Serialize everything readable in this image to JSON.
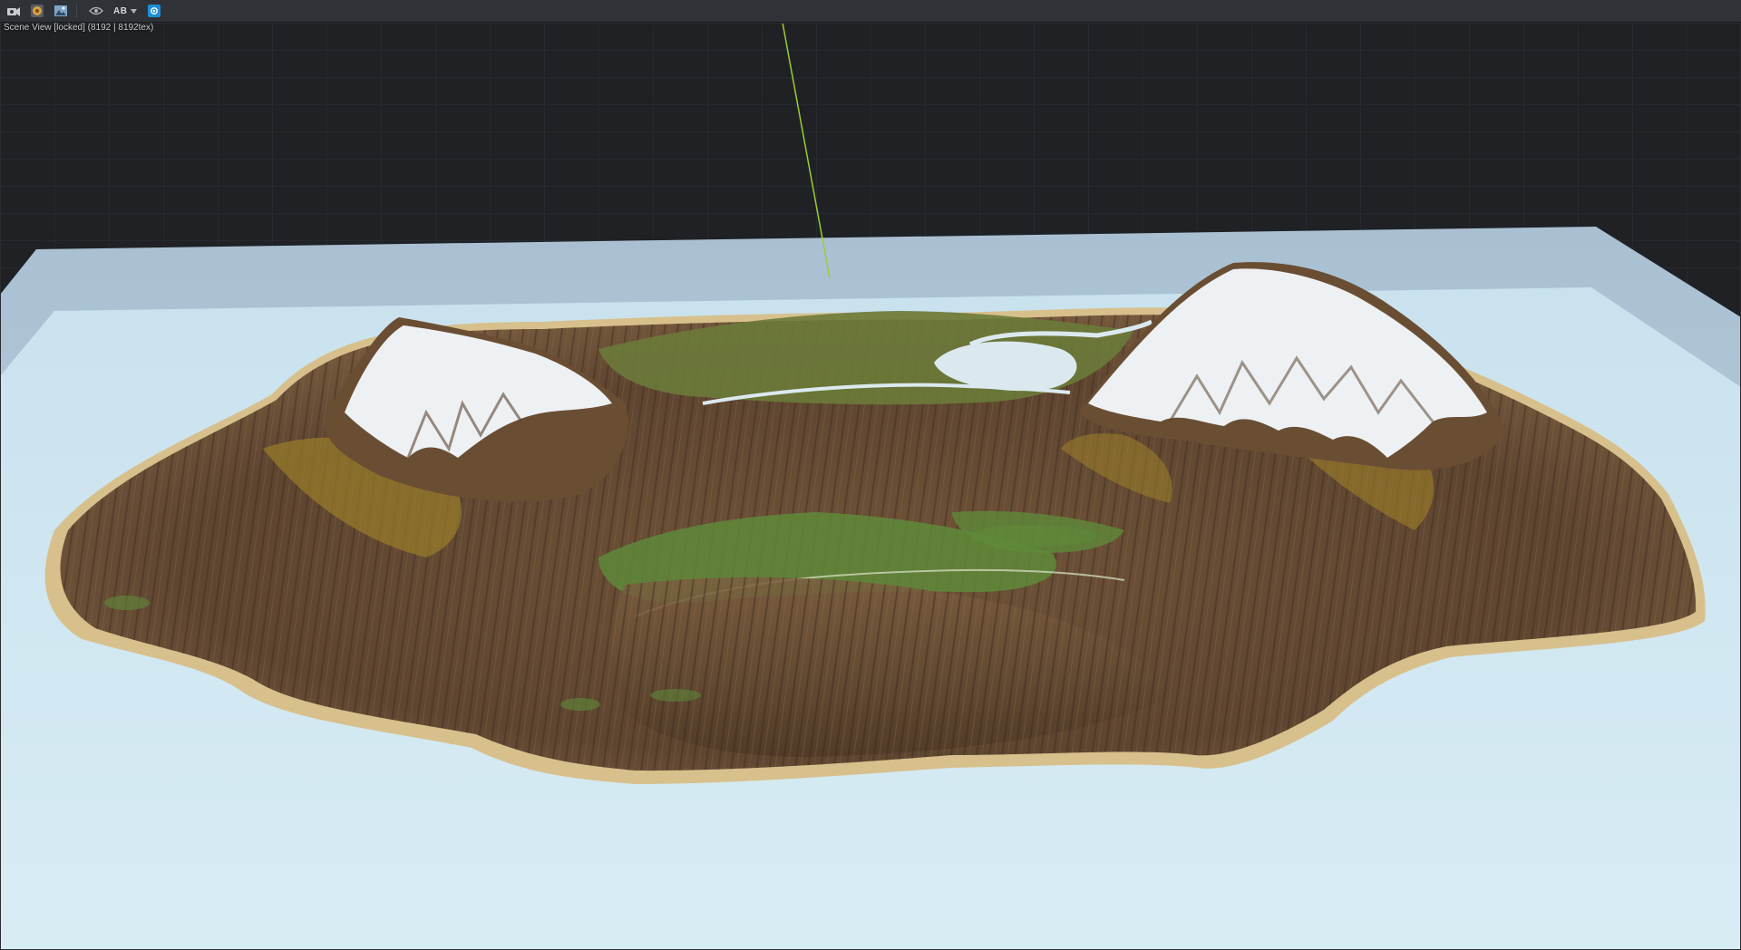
{
  "toolbar": {
    "buttons": [
      {
        "name": "camera-options-icon"
      },
      {
        "name": "render-settings-icon"
      },
      {
        "name": "image-export-icon"
      },
      {
        "name": "visibility-eye-icon"
      }
    ],
    "ab_label": "AB",
    "record_button": {
      "name": "capture-icon",
      "color": "#1e90d6"
    }
  },
  "viewport": {
    "label": "Scene View [locked] (8192 | 8192tex)"
  },
  "colors": {
    "background": "#1f2124",
    "grid_line": "#2d3035",
    "water": "#cfe6f0",
    "snow": "#eef1f3",
    "rock": "#6b4f35",
    "grass": "#5f8a3a",
    "sand": "#d9c38f",
    "axis_line": "#9acd32"
  }
}
